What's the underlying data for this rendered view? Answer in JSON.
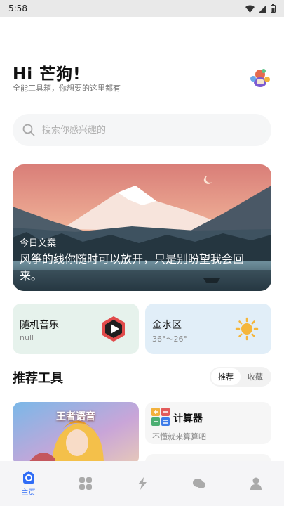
{
  "status_bar": {
    "time": "5:58"
  },
  "header": {
    "greeting": "Hi 芒狗!",
    "subtitle": "全能工具箱，你想要的这里都有"
  },
  "search": {
    "placeholder": "搜索你感兴趣的"
  },
  "banner": {
    "tag": "今日文案",
    "text": "风筝的线你随时可以放开，只是别盼望我会回来。"
  },
  "cards": {
    "music": {
      "title": "随机音乐",
      "subtitle": "null"
    },
    "weather": {
      "title": "金水区",
      "subtitle": "36°～26°"
    }
  },
  "tools_section": {
    "title": "推荐工具",
    "tabs": [
      "推荐",
      "收藏"
    ]
  },
  "tools": {
    "featured": {
      "label": "王者语音"
    },
    "calculator": {
      "name": "计算器",
      "desc": "不懂就来算算吧"
    }
  },
  "bottom_nav": {
    "home_label": "主页"
  },
  "colors": {
    "accent": "#2f6cf6",
    "music_card": "#e6f2ec",
    "weather_card": "#e1eef8",
    "sun": "#f5b63b"
  }
}
